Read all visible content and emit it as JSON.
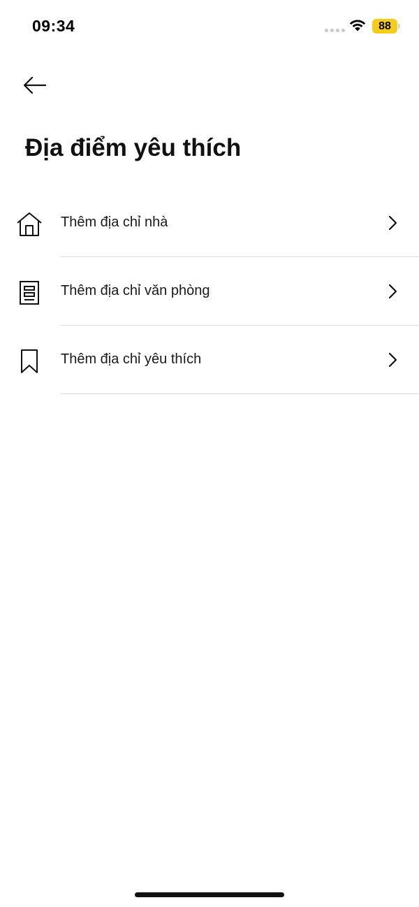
{
  "status_bar": {
    "time": "09:34",
    "battery_level": "88",
    "icons": [
      "signal-dots-icon",
      "wifi-icon",
      "battery-icon"
    ],
    "battery_color": "#f5cc1a"
  },
  "header": {
    "back_icon": "arrow-left-icon",
    "title": "Địa điểm yêu thích"
  },
  "favorites": {
    "items": [
      {
        "label": "Thêm địa chỉ nhà",
        "icon": "home-icon"
      },
      {
        "label": "Thêm địa chỉ văn phòng",
        "icon": "office-building-icon"
      },
      {
        "label": "Thêm địa chỉ yêu thích",
        "icon": "bookmark-icon"
      }
    ],
    "chevron_icon": "chevron-right-icon"
  }
}
